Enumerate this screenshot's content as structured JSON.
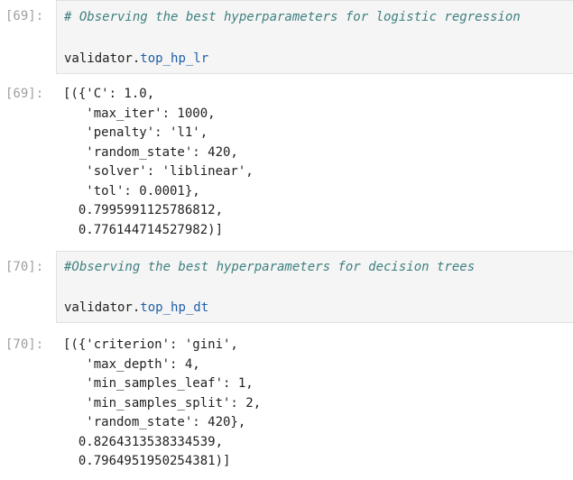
{
  "cells": [
    {
      "in_prompt": "[69]:",
      "comment": "# Observing the best hyperparameters for logistic regression",
      "code_object": "validator",
      "code_dot": ".",
      "code_attr": "top_hp_lr",
      "out_prompt": "[69]:",
      "output_lines": [
        "[({'C': 1.0,",
        "   'max_iter': 1000,",
        "   'penalty': 'l1',",
        "   'random_state': 420,",
        "   'solver': 'liblinear',",
        "   'tol': 0.0001},",
        "  0.7995991125786812,",
        "  0.776144714527982)]"
      ]
    },
    {
      "in_prompt": "[70]:",
      "comment": "#Observing the best hyperparameters for decision trees",
      "code_object": "validator",
      "code_dot": ".",
      "code_attr": "top_hp_dt",
      "out_prompt": "[70]:",
      "output_lines": [
        "[({'criterion': 'gini',",
        "   'max_depth': 4,",
        "   'min_samples_leaf': 1,",
        "   'min_samples_split': 2,",
        "   'random_state': 420},",
        "  0.8264313538334539,",
        "  0.7964951950254381)]"
      ]
    }
  ]
}
